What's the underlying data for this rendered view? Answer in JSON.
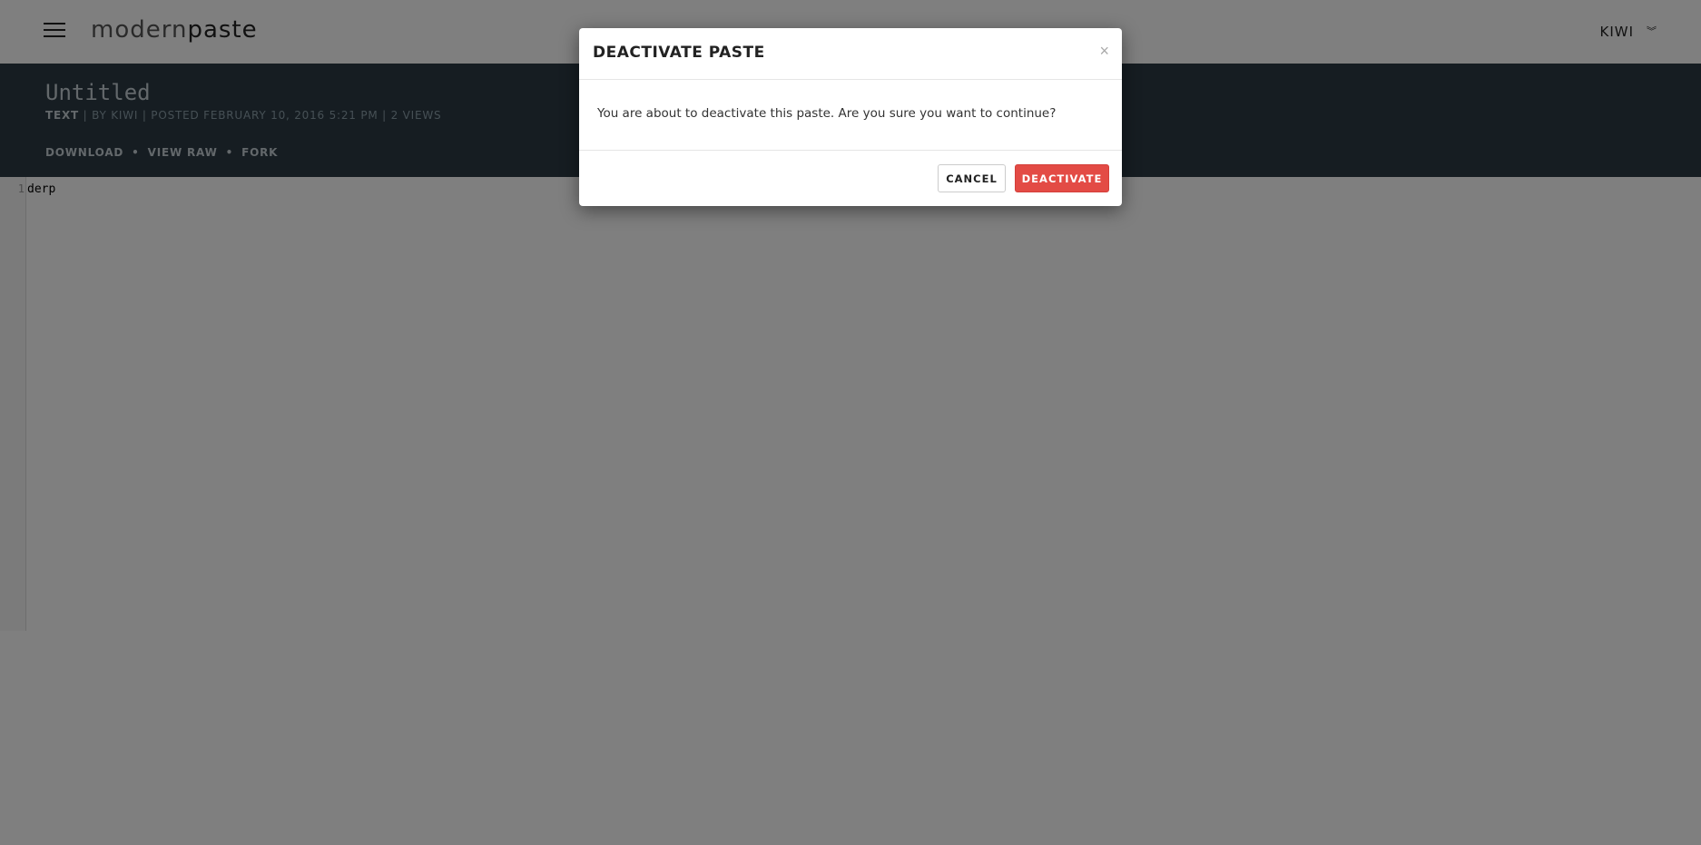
{
  "navbar": {
    "brand_part1": "modern",
    "brand_part2": "paste",
    "user": "KIWI",
    "chevron": "︾"
  },
  "paste": {
    "title": "Untitled",
    "language": "TEXT",
    "meta": " | BY KIWI | POSTED FEBRUARY 10, 2016 5:21 PM | 2 VIEWS",
    "actions": {
      "download": "DOWNLOAD",
      "view_raw": "VIEW RAW",
      "fork": "FORK",
      "separator": "•"
    }
  },
  "code": {
    "lines": [
      {
        "number": "1",
        "text": "derp"
      }
    ]
  },
  "modal": {
    "title": "DEACTIVATE PASTE",
    "close": "×",
    "message": "You are about to deactivate this paste. Are you sure you want to continue?",
    "cancel_label": "CANCEL",
    "confirm_label": "DEACTIVATE"
  },
  "colors": {
    "header_bg": "#2c3a44",
    "danger": "#e34b45"
  }
}
